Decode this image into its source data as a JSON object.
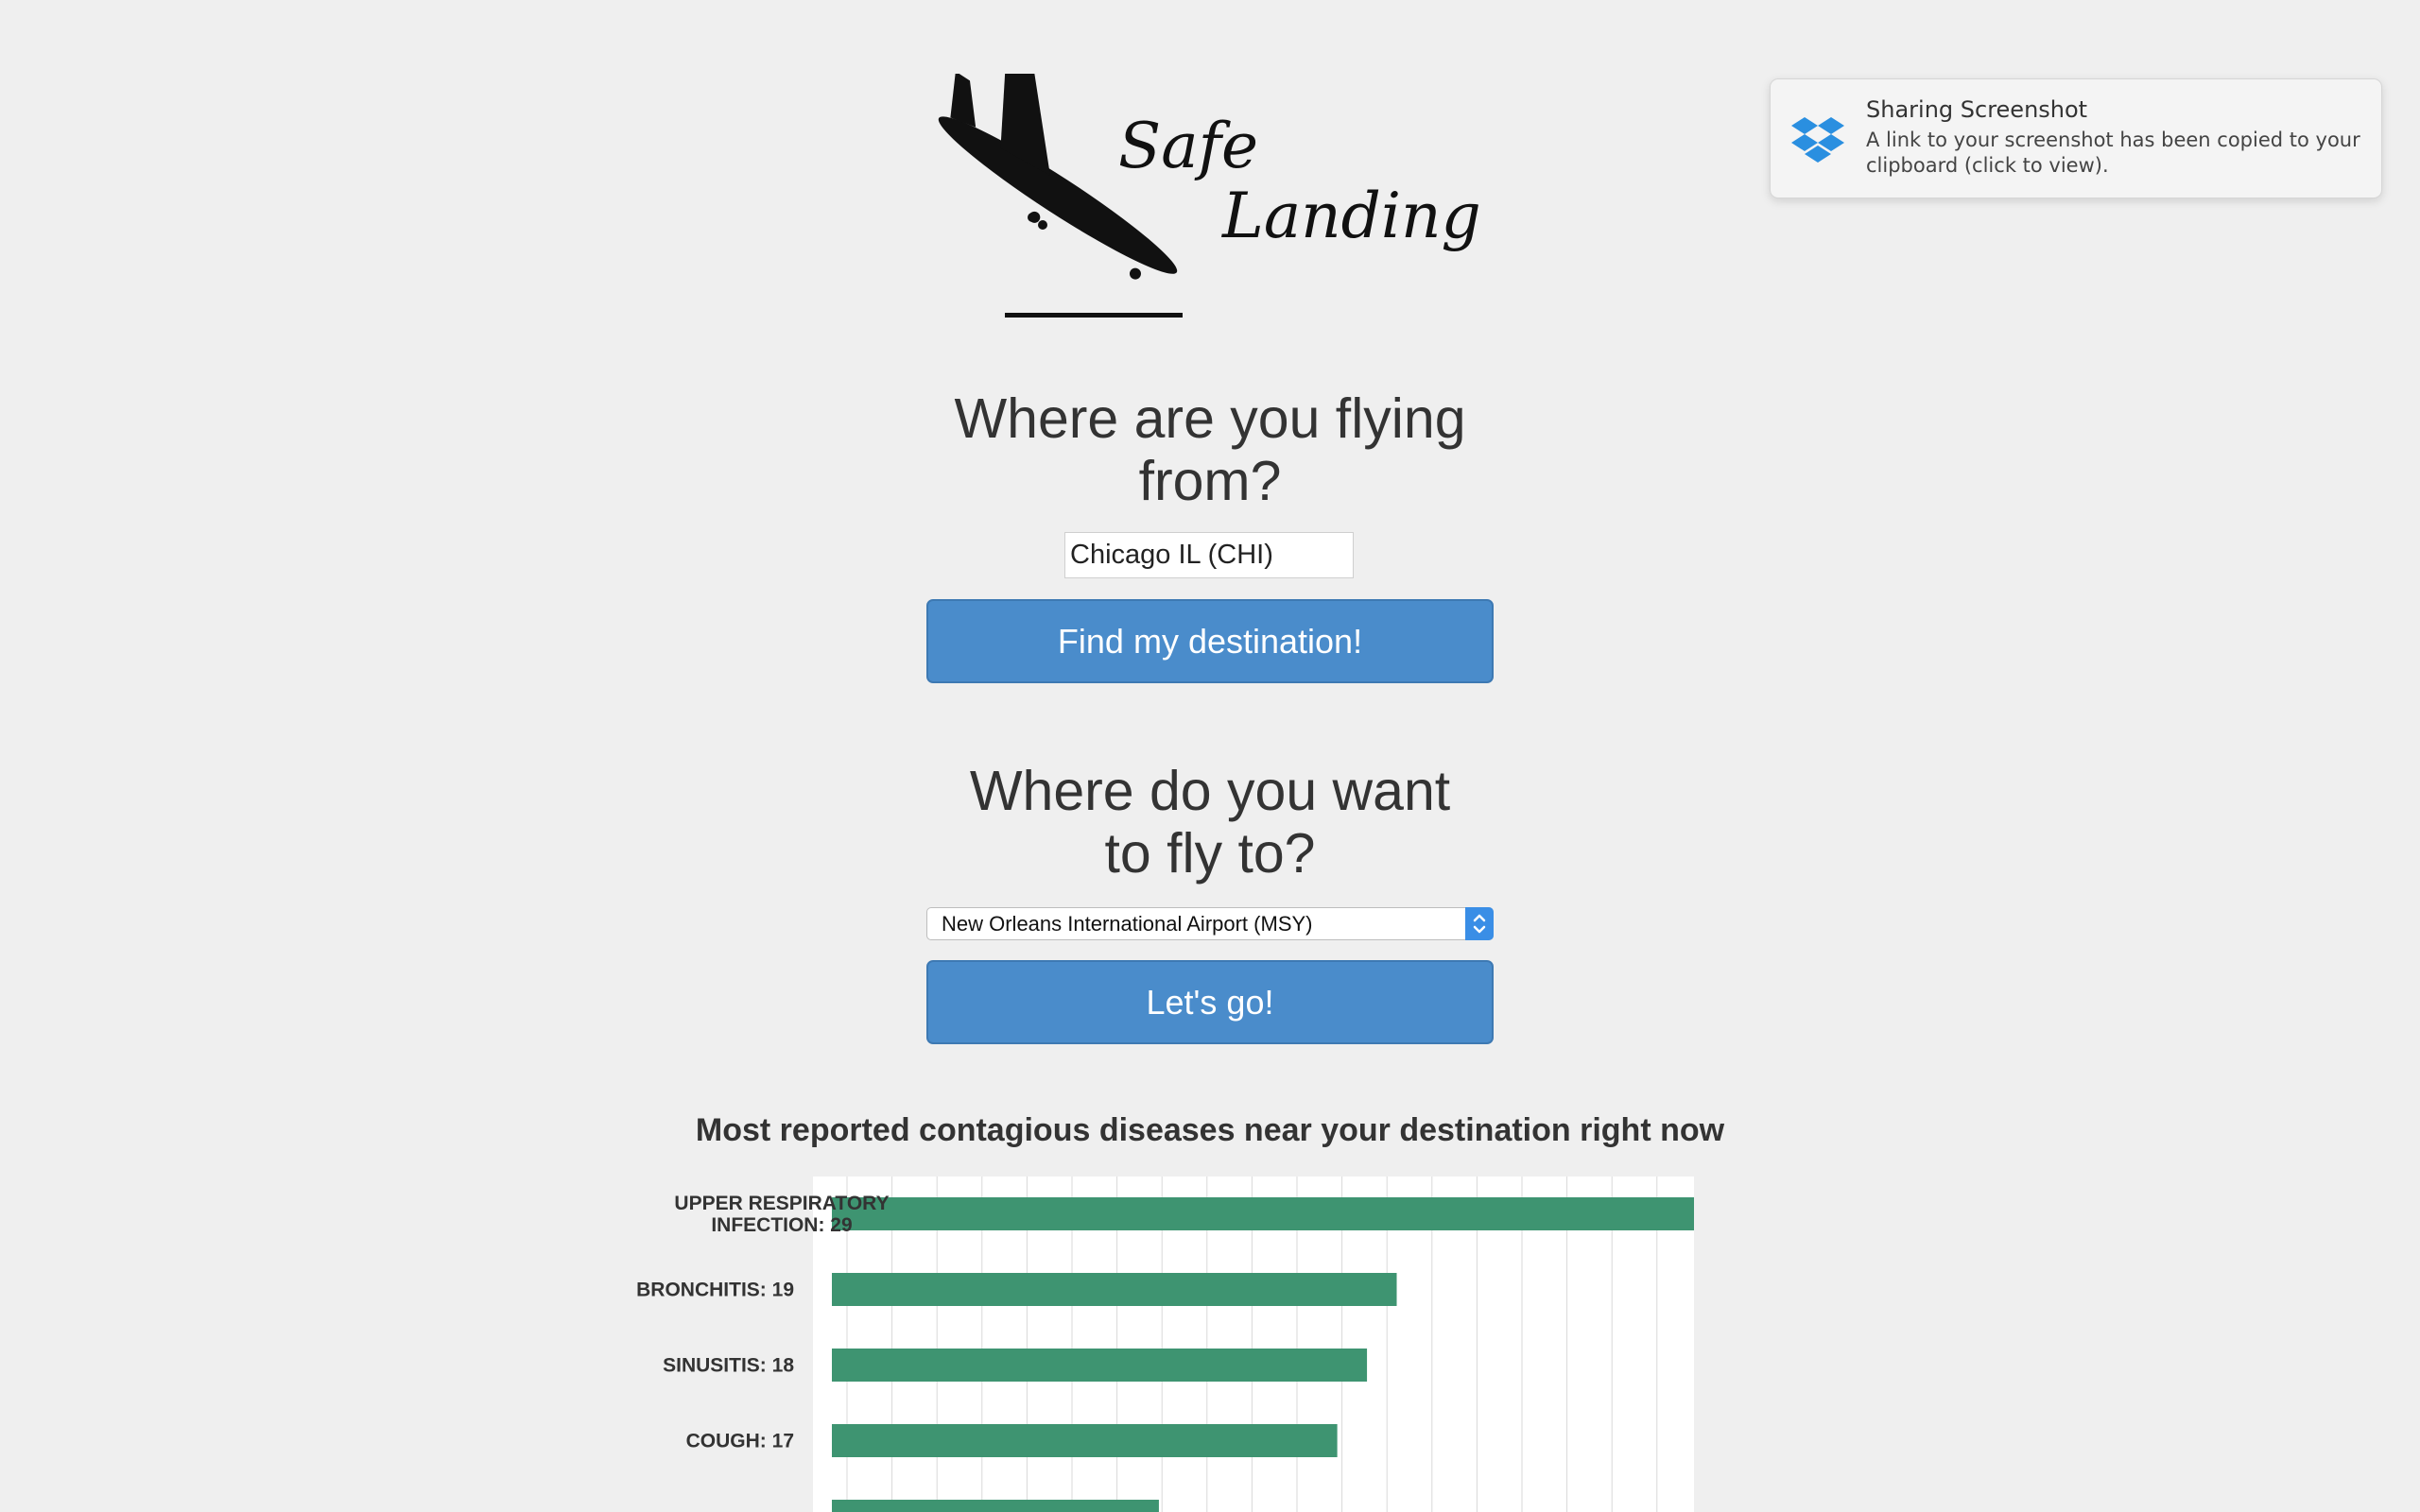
{
  "logo": {
    "line1": "Safe",
    "line2": "Landing"
  },
  "origin": {
    "heading_line1": "Where are you flying",
    "heading_line2": "from?",
    "input_value": "Chicago IL (CHI)",
    "button_label": "Find my destination!"
  },
  "destination": {
    "heading_line1": "Where do you want",
    "heading_line2": "to fly to?",
    "selected_option": "New Orleans International Airport (MSY)",
    "button_label": "Let's go!"
  },
  "notification": {
    "icon": "dropbox-icon",
    "title": "Sharing Screenshot",
    "body": "A link to your screenshot has been copied to your clipboard (click to view)."
  },
  "colors": {
    "background": "#efefef",
    "button": "#4a8ccb",
    "bar": "#3e9471",
    "select_arrow": "#3a8ee6"
  },
  "chart_data": {
    "type": "bar",
    "orientation": "horizontal",
    "title": "Most reported contagious diseases near your destination right now",
    "category_labels": [
      [
        "UPPER RESPIRATORY",
        "INFECTION: 29"
      ],
      [
        "BRONCHITIS: 19"
      ],
      [
        "SINUSITIS: 18"
      ],
      [
        "COUGH: 17"
      ]
    ],
    "values": [
      29,
      19,
      18,
      17,
      11
    ],
    "xlim": [
      0,
      29
    ],
    "grid": true,
    "legend": "none"
  }
}
